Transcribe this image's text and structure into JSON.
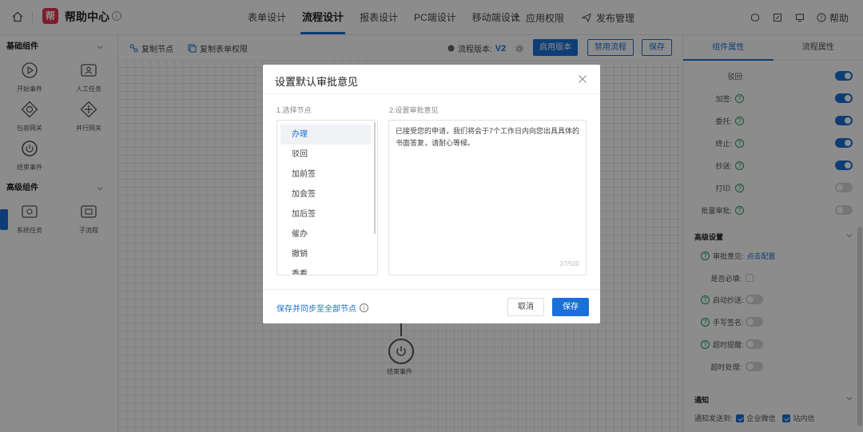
{
  "header": {
    "logo_text": "帮",
    "title": "帮助中心",
    "tabs": [
      {
        "label": "表单设计"
      },
      {
        "label": "流程设计"
      },
      {
        "label": "报表设计"
      },
      {
        "label": "PC端设计"
      },
      {
        "label": "移动端设计"
      }
    ],
    "app_permission": "应用权限",
    "publish_manage": "发布管理",
    "help": "帮助"
  },
  "left": {
    "basic_title": "基础组件",
    "basic_items": [
      {
        "label": "开始事件",
        "icon": "play-circle-icon"
      },
      {
        "label": "人工任务",
        "icon": "user-task-icon"
      },
      {
        "label": "包容网关",
        "icon": "inclusive-gateway-icon"
      },
      {
        "label": "并行网关",
        "icon": "parallel-gateway-icon"
      },
      {
        "label": "结束事件",
        "icon": "power-icon"
      }
    ],
    "advanced_title": "高级组件",
    "advanced_items": [
      {
        "label": "系统任务",
        "icon": "system-task-icon"
      },
      {
        "label": "子流程",
        "icon": "subprocess-icon"
      }
    ]
  },
  "toolbar": {
    "copy_node": "复制节点",
    "copy_form_perm": "复制表单权限",
    "version_label": "流程版本:",
    "version_value": "V2",
    "enable_version": "启用版本",
    "disable_flow": "禁用流程",
    "save": "保存"
  },
  "canvas": {
    "end_event_label": "结束事件"
  },
  "right": {
    "tab_component": "组件属性",
    "tab_flow": "流程属性",
    "rows": [
      {
        "label": "驳回:",
        "on": true,
        "help": false
      },
      {
        "label": "加签:",
        "on": true,
        "help": true
      },
      {
        "label": "委托:",
        "on": true,
        "help": true
      },
      {
        "label": "终止:",
        "on": true,
        "help": true
      },
      {
        "label": "抄送:",
        "on": true,
        "help": true
      },
      {
        "label": "打印:",
        "on": false,
        "help": true
      },
      {
        "label": "批量审批:",
        "on": false,
        "help": true
      }
    ],
    "advanced_title": "高级设置",
    "approval_opinion": "审批意见:",
    "click_config": "点击配置",
    "required": "是否必填:",
    "start_cc": "启动抄送:",
    "handwritten_sign": "手写签名:",
    "timeout_remind": "超时提醒:",
    "timeout_handle": "超时处理:",
    "notify_title": "通知",
    "notify_to": "通知发送到:",
    "wecom": "企业微信",
    "station_msg": "站内信"
  },
  "modal": {
    "title": "设置默认审批意见",
    "step1": "1.选择节点",
    "step2": "2.设置审批意见",
    "nodes": [
      "办理",
      "驳回",
      "加前签",
      "加会签",
      "加后签",
      "催办",
      "撤销",
      "香看"
    ],
    "opinion_text": "已接受您的申请，我们将会于7个工作日内向您出具具体的书面答复，请耐心等候。",
    "counter": "37/500",
    "sync_all": "保存并同步至全部节点",
    "cancel": "取消",
    "save": "保存"
  }
}
